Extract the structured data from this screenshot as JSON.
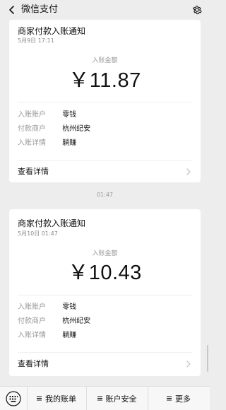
{
  "header": {
    "title": "微信支付",
    "back_icon": "chevron-left-icon",
    "settings_icon": "gear-icon"
  },
  "cards": [
    {
      "title": "商家付款入账通知",
      "time": "5月9日 17:11",
      "amount_label": "入账金额",
      "amount": "￥11.87",
      "rows": [
        {
          "label": "入账账户",
          "value": "零钱"
        },
        {
          "label": "付款商户",
          "value": "杭州纪安"
        },
        {
          "label": "入账详情",
          "value": "躺赚"
        }
      ],
      "details_label": "查看详情"
    },
    {
      "title": "商家付款入账通知",
      "time": "5月10日 01:47",
      "amount_label": "入账金额",
      "amount": "￥10.43",
      "rows": [
        {
          "label": "入账账户",
          "value": "零钱"
        },
        {
          "label": "付款商户",
          "value": "杭州纪安"
        },
        {
          "label": "入账详情",
          "value": "躺赚"
        }
      ],
      "details_label": "查看详情"
    }
  ],
  "time_divider": "01:47",
  "bottom_bar": {
    "keyboard_icon": "keyboard-icon",
    "items": [
      {
        "label": "我的账单",
        "icon": "menu-icon"
      },
      {
        "label": "账户安全",
        "icon": "menu-icon"
      },
      {
        "label": "更多",
        "icon": "menu-icon"
      }
    ]
  },
  "colors": {
    "background": "#ededed",
    "card": "#ffffff",
    "muted_text": "#999999",
    "text": "#111111"
  }
}
